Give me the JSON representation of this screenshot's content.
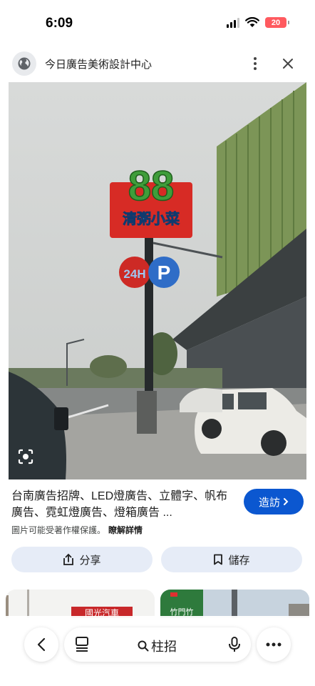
{
  "status_bar": {
    "time": "6:09",
    "battery": "20"
  },
  "header": {
    "site_title": "今日廣告美術設計中心"
  },
  "photo": {
    "sign_number": "88",
    "sign_text": "清粥小菜",
    "sign_24h": "24H",
    "sign_parking": "P"
  },
  "caption": {
    "title": "台南廣告招牌、LED燈廣告、立體字、帆布廣告、霓虹燈廣告、燈箱廣告 ...",
    "visit_label": "造訪",
    "copyright_text": "圖片可能受著作權保護。",
    "learn_more": "瞭解詳情"
  },
  "actions": {
    "share_label": "分享",
    "save_label": "儲存"
  },
  "thumbnails": {
    "thumb1_text": "國光汽車",
    "thumb2_text": "竹門竹"
  },
  "bottom_bar": {
    "search_query": "柱招"
  },
  "colors": {
    "accent": "#0b57d0",
    "pill_bg": "#e6ecf7",
    "battery_low": "#ff5a5f"
  }
}
